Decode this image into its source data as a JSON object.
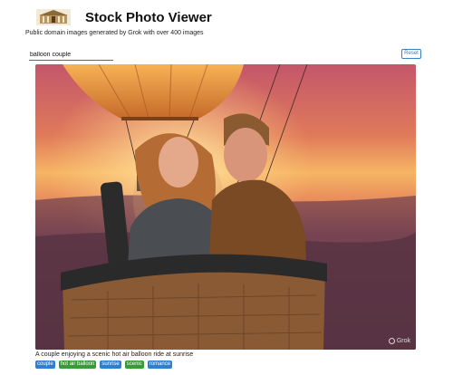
{
  "app": {
    "title": "Stock Photo Viewer",
    "subtitle": "Public domain images generated by Grok with over 400 images",
    "logo_icon": "museum-building-icon"
  },
  "search": {
    "value": "balloon couple",
    "placeholder": ""
  },
  "reset_label": "Reset",
  "photo": {
    "subject": "couple in hot air balloon basket at sunset",
    "watermark": "Grok",
    "caption": "A couple enjoying a scenic hot air balloon ride at sunrise"
  },
  "tags": [
    {
      "label": "couple",
      "color": "#2f7fd1"
    },
    {
      "label": "hot air balloon",
      "color": "#3a9a3a"
    },
    {
      "label": "sunrise",
      "color": "#2f7fd1"
    },
    {
      "label": "scenic",
      "color": "#3a9a3a"
    },
    {
      "label": "romance",
      "color": "#2f7fd1"
    }
  ]
}
